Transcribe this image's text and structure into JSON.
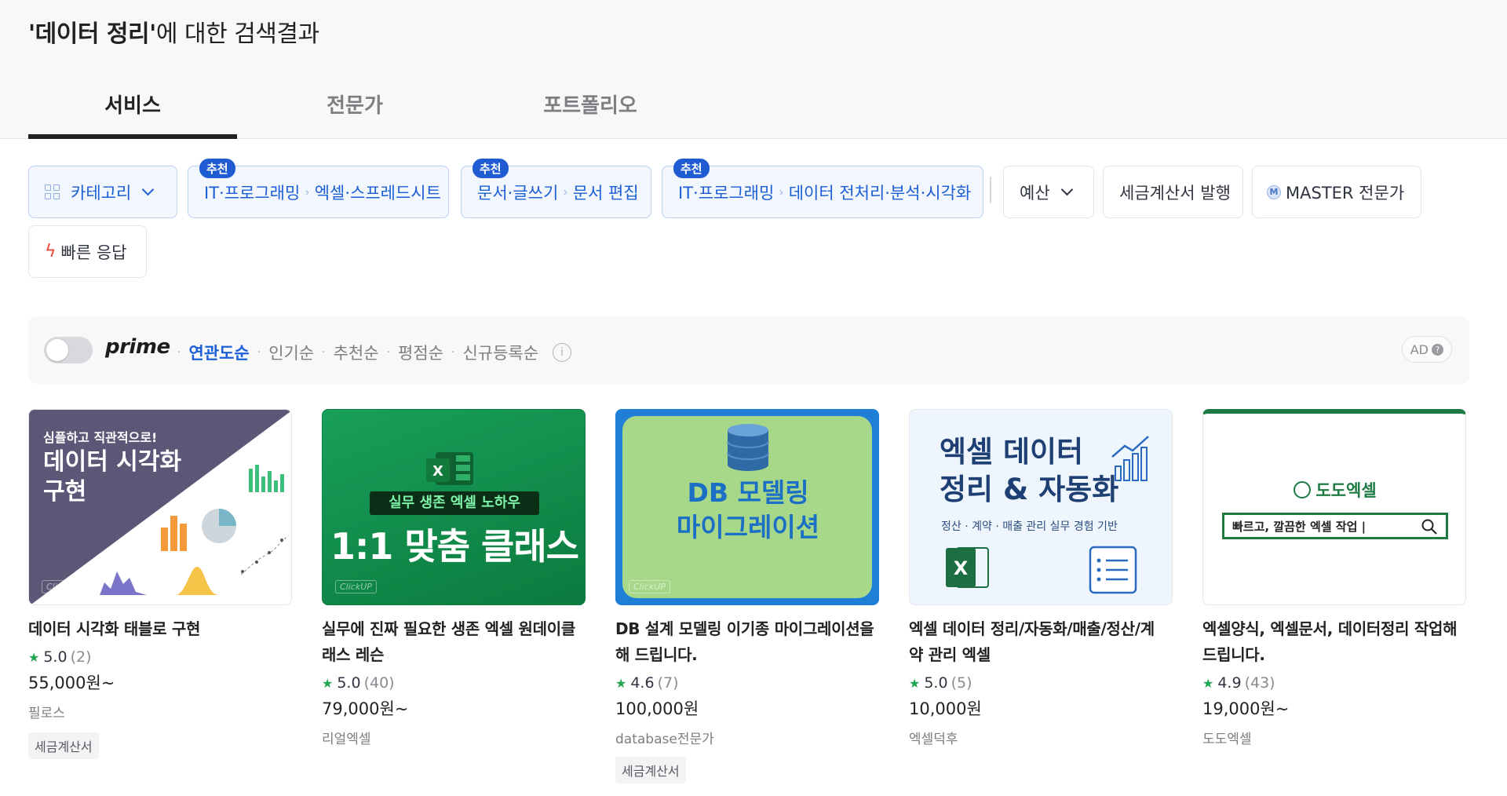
{
  "header": {
    "query": "'데이터 정리'",
    "title_suffix": "에 대한 검색결과",
    "tabs": [
      {
        "label": "서비스"
      },
      {
        "label": "전문가"
      },
      {
        "label": "포트폴리오"
      }
    ]
  },
  "filters": {
    "category": "카테고리",
    "recommend_badge": "추천",
    "recommended": [
      {
        "parent": "IT·프로그래밍",
        "child": "엑셀·스프레드시트"
      },
      {
        "parent": "문서·글쓰기",
        "child": "문서 편집"
      },
      {
        "parent": "IT·프로그래밍",
        "child": "데이터 전처리·분석·시각화"
      }
    ],
    "budget": "예산",
    "tax_invoice": "세금계산서 발행",
    "master_badge": "M",
    "master": "MASTER 전문가",
    "fast_response": "빠른 응답"
  },
  "sortbar": {
    "prime": "prime",
    "sorts": [
      "연관도순",
      "인기순",
      "추천순",
      "평점순",
      "신규등록순"
    ],
    "active_sort": "연관도순",
    "ad_label": "AD"
  },
  "cards": [
    {
      "title": "데이터 시각화 태블로 구현",
      "rating": "5.0",
      "count": "(2)",
      "price": "55,000원~",
      "seller": "필로스",
      "tag": "세금계산서",
      "thumb": {
        "line1": "심플하고 직관적으로!",
        "line2": "데이터 시각화",
        "line3": "구현",
        "brand": "ClickUP"
      }
    },
    {
      "title": "실무에 진짜 필요한 생존 엑셀 원데이클래스 레슨",
      "title_line1": "실무에 진짜 필요한 생존 엑셀 원데이클",
      "title_line2": "래스 레슨",
      "rating": "5.0",
      "count": "(40)",
      "price": "79,000원~",
      "seller": "리얼엑셀",
      "tag": "",
      "thumb": {
        "banner": "실무 생존 엑셀 노하우",
        "headline": "1:1 맞춤 클래스",
        "brand": "ClickUP"
      }
    },
    {
      "title_line1": "DB 설계 모델링 이기종 마이그레이션을",
      "title_line2": "해 드립니다.",
      "rating": "4.6",
      "count": "(7)",
      "price": "100,000원",
      "seller": "database전문가",
      "tag": "세금계산서",
      "thumb": {
        "line1": "DB 모델링",
        "line2": "마이그레이션",
        "brand": "ClickUP"
      }
    },
    {
      "title_line1": "엑셀 데이터 정리/자동화/매출/정산/계",
      "title_line2": "약 관리 엑셀",
      "rating": "5.0",
      "count": "(5)",
      "price": "10,000원",
      "seller": "엑셀덕후",
      "tag": "",
      "thumb": {
        "line1": "엑셀 데이터",
        "line2": "정리 & 자동화",
        "sub": "정산 · 계약 · 매출 관리 실무 경험 기반"
      }
    },
    {
      "title_line1": "엑셀양식, 엑셀문서, 데이터정리 작업해",
      "title_line2": "드립니다.",
      "rating": "4.9",
      "count": "(43)",
      "price": "19,000원~",
      "seller": "도도엑셀",
      "tag": "",
      "thumb": {
        "logo": "도도엑셀",
        "search": "빠르고, 깔끔한 엑셀 작업 |"
      }
    }
  ],
  "colors": {
    "accent": "#1c5fd6",
    "star": "#22a652",
    "excel_green": "#1d6f42"
  }
}
